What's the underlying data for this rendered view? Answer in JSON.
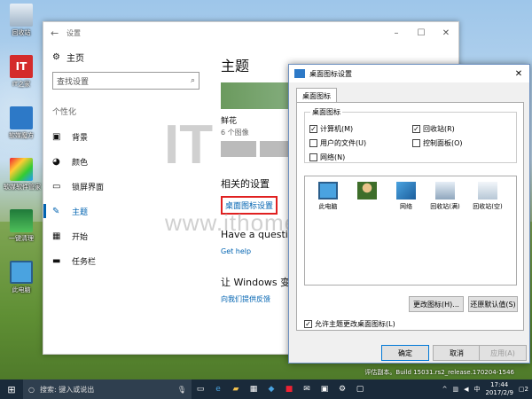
{
  "desktop": {
    "icons": [
      {
        "label": "回收站"
      },
      {
        "label": "IT之家"
      },
      {
        "label": "软媒魔方"
      },
      {
        "label": "软媒软件管家"
      },
      {
        "label": "一键清理"
      },
      {
        "label": "此电脑"
      }
    ],
    "watermark_url": "www.ithome.com",
    "watermark_logo": "IT",
    "eval_text": "评估副本。Build 15031.rs2_release.170204-1546"
  },
  "settings": {
    "title": "设置",
    "home": "主页",
    "search_placeholder": "查找设置",
    "group": "个性化",
    "nav": [
      "背景",
      "颜色",
      "锁屏界面",
      "主题",
      "开始",
      "任务栏"
    ],
    "active_index": 3,
    "page_title": "主题",
    "theme_name": "鲜花",
    "theme_count": "6 个图像",
    "related_title": "相关的设置",
    "desktop_icon_link": "桌面图标设置",
    "question": "Have a questio",
    "get_help": "Get help",
    "better": "让 Windows 变",
    "feedback": "向我们提供反馈"
  },
  "dialog": {
    "title": "桌面图标设置",
    "tab": "桌面图标",
    "group_title": "桌面图标",
    "checkboxes": [
      {
        "label": "计算机(M)",
        "checked": true
      },
      {
        "label": "回收站(R)",
        "checked": true
      },
      {
        "label": "用户的文件(U)",
        "checked": false
      },
      {
        "label": "控制面板(O)",
        "checked": false
      },
      {
        "label": "网络(N)",
        "checked": false
      }
    ],
    "icons": [
      {
        "label": "此电脑"
      },
      {
        "label": ""
      },
      {
        "label": "网络"
      },
      {
        "label": "回收站(满)"
      },
      {
        "label": "回收站(空)"
      }
    ],
    "change_icon": "更改图标(H)...",
    "restore_default": "还原默认值(S)",
    "allow_themes": "允许主题更改桌面图标(L)",
    "ok": "确定",
    "cancel": "取消",
    "apply": "应用(A)"
  },
  "taskbar": {
    "search_text": "搜索: 键入或说出",
    "time": "17:44",
    "date": "2017/2/9",
    "notification_count": "2"
  }
}
